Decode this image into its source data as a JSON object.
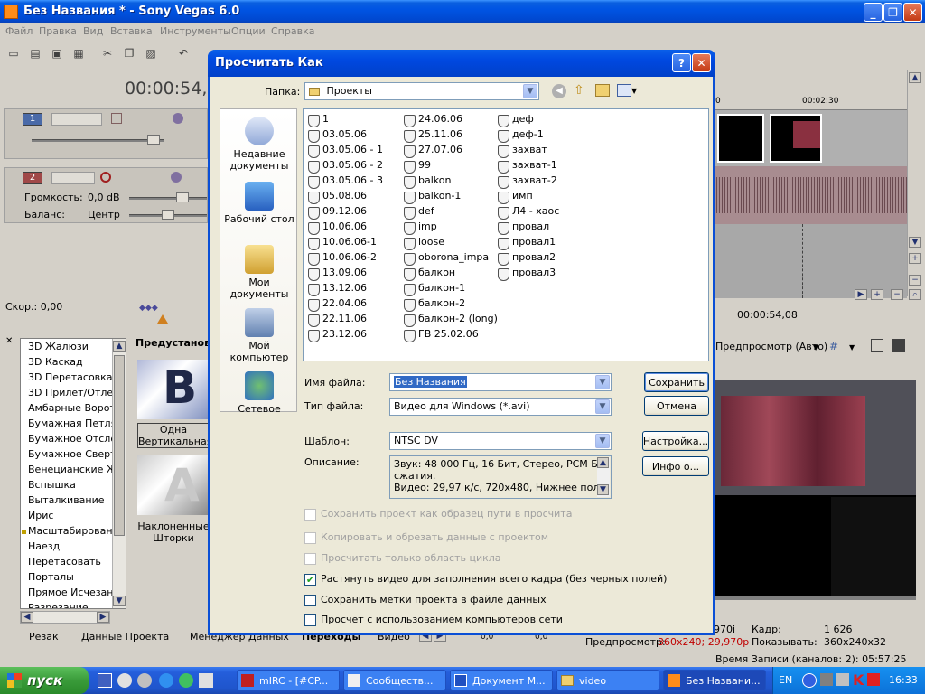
{
  "app": {
    "title": "Без Названия * - Sony Vegas 6.0",
    "menu": [
      "Файл",
      "Правка",
      "Вид",
      "Вставка",
      "Инструменты",
      "Опции",
      "Справка"
    ],
    "time_display": "00:00:54,0",
    "ruler_labels": [
      "0",
      "00:02:30"
    ],
    "track1": {
      "number": "1"
    },
    "track2": {
      "number": "2",
      "volume_label": "Громкость:",
      "volume_value": "0,0 dB",
      "pan_label": "Баланс:",
      "pan_value": "Центр"
    },
    "speed_label": "Скор.: 0,00",
    "cursor_time": "00:00:54,08",
    "transitions": [
      "3D Жалюзи",
      "3D Каскад",
      "3D Перетасовка",
      "3D Прилет/Отлет",
      "Амбарные Ворота",
      "Бумажная Петля",
      "Бумажное Отслоение",
      "Бумажное Свертывание",
      "Венецианские Жалюзи",
      "Вспышка",
      "Выталкивание",
      "Ирис",
      "Масштабирование",
      "Наезд",
      "Перетасовать",
      "Порталы",
      "Прямое Исчезание",
      "Разрезание"
    ],
    "presets_title": "Предустанов",
    "preset1_label": "Одна Вертикальная",
    "preset2_label": "Наклоненные Шторки",
    "bottom_tabs": [
      "Резак",
      "Данные Проекта",
      "Менеджер Данных",
      "Переходы",
      "Видео"
    ],
    "preview_mode": "Предпросмотр (Авто)",
    "frame_label": "Кадр:",
    "frame_value": "1 626",
    "display_label": "Показывать:",
    "display_value": "360x240x32",
    "fps_partial": "970i",
    "preview_label": "Предпросмотр:",
    "preview_value": "360x240; 29,970p",
    "rec_time": "Время Записи (каналов: 2): 05:57:25",
    "zero1": "0,0",
    "zero2": "0,0"
  },
  "dialog": {
    "title": "Просчитать Как",
    "folder_label": "Папка:",
    "folder_value": "Проекты",
    "places": [
      "Недавние документы",
      "Рабочий стол",
      "Мои документы",
      "Мой компьютер",
      "Сетевое"
    ],
    "files_col1": [
      "1",
      "03.05.06",
      "03.05.06 - 1",
      "03.05.06 - 2",
      "03.05.06 - 3",
      "05.08.06",
      "09.12.06",
      "10.06.06",
      "10.06.06-1",
      "10.06.06-2",
      "13.09.06",
      "13.12.06",
      "22.04.06",
      "22.11.06",
      "23.12.06"
    ],
    "files_col2": [
      "24.06.06",
      "25.11.06",
      "27.07.06",
      "99",
      "balkon",
      "balkon-1",
      "def",
      "imp",
      "loose",
      "oborona_impa",
      "балкон",
      "балкон-1",
      "балкон-2",
      "балкон-2 (long)",
      "ГВ 25.02.06"
    ],
    "files_col3": [
      "деф",
      "деф-1",
      "захват",
      "захват-1",
      "захват-2",
      "имп",
      "Л4 - хаос",
      "провал",
      "провал1",
      "провал2",
      "провал3"
    ],
    "filename_label": "Имя файла:",
    "filename_value": "Без Названия",
    "filetype_label": "Тип файла:",
    "filetype_value": "Видео для Windows (*.avi)",
    "template_label": "Шаблон:",
    "template_value": "NTSC DV",
    "description_label": "Описание:",
    "description_line1": "Звук: 48 000 Гц, 16 Бит, Стерео, PCM Без",
    "description_line2": "сжатия.",
    "description_line3": "Видео: 29,97 к/с, 720x480, Нижнее поле",
    "save_button": "Сохранить",
    "cancel_button": "Отмена",
    "settings_button": "Настройка...",
    "info_button": "Инфо о...",
    "checkboxes": [
      {
        "label": "Сохранить проект как образец пути в просчита",
        "checked": false,
        "enabled": false
      },
      {
        "label": "Копировать и обрезать данные с проектом",
        "checked": false,
        "enabled": false
      },
      {
        "label": "Просчитать только область цикла",
        "checked": false,
        "enabled": false
      },
      {
        "label": "Растянуть видео для заполнения всего кадра (без черных полей)",
        "checked": true,
        "enabled": true
      },
      {
        "label": "Сохранить метки проекта в файле данных",
        "checked": false,
        "enabled": true
      },
      {
        "label": "Просчет с использованием компьютеров сети",
        "checked": false,
        "enabled": true
      }
    ]
  },
  "taskbar": {
    "start": "пуск",
    "tasks": [
      "mIRC - [#CP...",
      "Сообществ...",
      "Документ М...",
      "video",
      "Без Названи..."
    ],
    "lang": "EN",
    "clock": "16:33"
  }
}
